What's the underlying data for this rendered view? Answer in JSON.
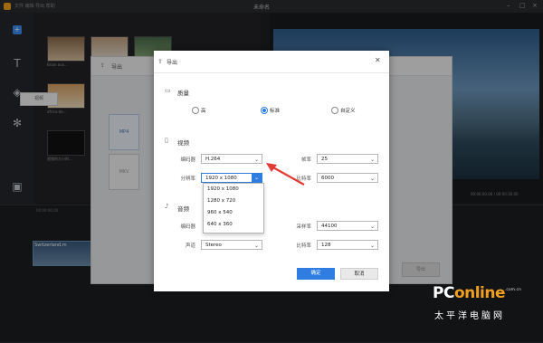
{
  "app": {
    "title": "未命名",
    "menu": "文件  编辑  导出  帮助"
  },
  "media": {
    "items": [
      {
        "label": "Brian aus..."
      },
      {
        "label": "wiuuxJxx..."
      },
      {
        "label": "flower-ds..."
      },
      {
        "label": "africa-de..."
      },
      {
        "label": "视频的大小时..."
      }
    ]
  },
  "background_dialog": {
    "title": "导出",
    "tab": "视频",
    "formats": [
      "MP4",
      "MKV"
    ],
    "export_button": "导出"
  },
  "timeline": {
    "clip_label": "Switzerland.m",
    "time_left": "00:00:00.00 / 00:00:30.00",
    "ruler_ticks": [
      "00:00:00.00",
      "00:00:05.00",
      "00:00:10.00",
      "00:00:15.00"
    ]
  },
  "export_dialog": {
    "title": "导出",
    "quality": {
      "title": "质量",
      "options": [
        {
          "label": "高",
          "selected": false
        },
        {
          "label": "标准",
          "selected": true
        },
        {
          "label": "自定义",
          "selected": false
        }
      ]
    },
    "video": {
      "title": "视频",
      "encoder_label": "编码器",
      "encoder_value": "H.264",
      "framerate_label": "帧率",
      "framerate_value": "25",
      "resolution_label": "分辨率",
      "resolution_value": "1920 x 1080",
      "bitrate_label": "比特率",
      "bitrate_value": "6000",
      "resolution_options": [
        "1920 x 1080",
        "1280 x 720",
        "960 x 540",
        "640 x 360"
      ]
    },
    "audio": {
      "title": "音频",
      "encoder_label": "编码器",
      "samplerate_label": "采样率",
      "samplerate_value": "44100",
      "channel_label": "声道",
      "channel_value": "Stereo",
      "bitrate_label": "比特率",
      "bitrate_value": "128"
    },
    "ok_button": "确定",
    "cancel_button": "取消"
  },
  "watermark": {
    "brand_1": "PC",
    "brand_2": "online",
    "domain": ".com.cn",
    "subtitle": "太平洋电脑网"
  },
  "colors": {
    "accent": "#2f7de1",
    "arrow": "#e53935"
  }
}
